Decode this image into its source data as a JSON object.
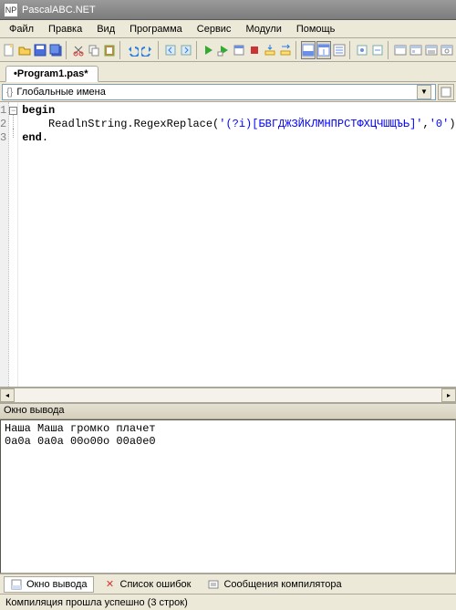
{
  "title": "PascalABC.NET",
  "menu": [
    "Файл",
    "Правка",
    "Вид",
    "Программа",
    "Сервис",
    "Модули",
    "Помощь"
  ],
  "tab_label": "•Program1.pas*",
  "class_selector": "Глобальные имена",
  "gutter_lines": [
    "1",
    "2",
    "3"
  ],
  "code": {
    "l1_kw": "begin",
    "l2_indent": "    ",
    "l2a": "ReadlnString.RegexReplace(",
    "l2s1": "'(?i)[БВГДЖЗЙКЛМНПРСТФХЦЧШЩЪЬ]'",
    "l2b": ",",
    "l2s2": "'0'",
    "l2c": ").Println",
    "l3_kw": "end",
    "l3_dot": "."
  },
  "output_title": "Окно вывода",
  "output_lines": [
    "Наша Маша громко плачет",
    "0а0а 0а0а 00о00о 00а0е0"
  ],
  "bottom_tabs": {
    "t1": "Окно вывода",
    "t2": "Список ошибок",
    "t3": "Сообщения компилятора"
  },
  "status": "Компиляция прошла успешно (3 строк)"
}
